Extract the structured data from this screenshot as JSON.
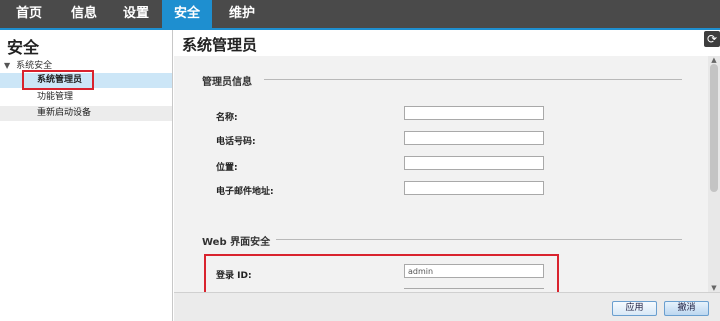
{
  "nav": {
    "tabs": [
      {
        "label": "首页"
      },
      {
        "label": "信息"
      },
      {
        "label": "设置"
      },
      {
        "label": "安全"
      },
      {
        "label": "维护"
      }
    ],
    "active_color": "#1e8fd0"
  },
  "sidebar": {
    "title": "安全",
    "group": "系统安全",
    "items": [
      {
        "label": "系统管理员"
      },
      {
        "label": "功能管理"
      },
      {
        "label": "重新启动设备"
      }
    ]
  },
  "main": {
    "title": "系统管理员",
    "refresh_icon": "refresh-icon",
    "admin_section": {
      "title": "管理员信息",
      "fields": [
        {
          "label": "名称:",
          "value": ""
        },
        {
          "label": "电话号码:",
          "value": ""
        },
        {
          "label": "位置:",
          "value": ""
        },
        {
          "label": "电子邮件地址:",
          "value": ""
        }
      ]
    },
    "web_section": {
      "title": "Web 界面安全",
      "login_label": "登录 ID:",
      "login_value": "admin"
    }
  },
  "footer": {
    "apply_label": "应用",
    "cancel_label": "撤消"
  },
  "colors": {
    "highlight_box": "#d9232e",
    "nav_bg": "#4a4a4a",
    "selected_item_bg": "#cce6f7"
  }
}
